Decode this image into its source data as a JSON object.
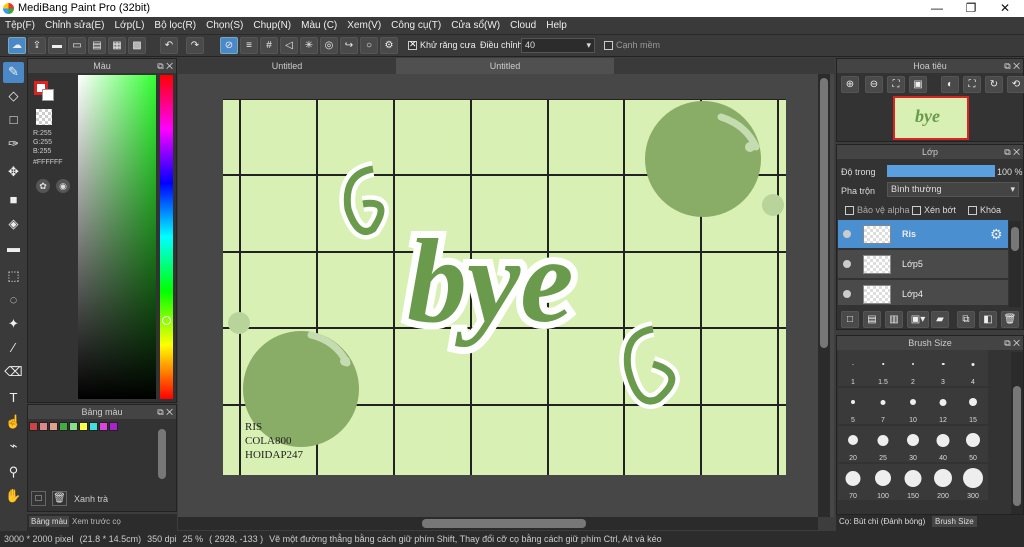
{
  "window": {
    "title": "MediBang Paint Pro (32bit)",
    "min": "—",
    "max": "❐",
    "close": "✕"
  },
  "menu": [
    "Tệp(F)",
    "Chỉnh sửa(E)",
    "Lớp(L)",
    "Bộ lọc(R)",
    "Chọn(S)",
    "Chụp(N)",
    "Màu (C)",
    "Xem(V)",
    "Công cụ(T)",
    "Cửa sổ(W)",
    "Cloud",
    "Help"
  ],
  "toolbar": {
    "antialias_label": "Khử răng cưa",
    "adjust_label": "Điều chỉnh",
    "adjust_value": "40",
    "edge_label": "Cạnh mềm"
  },
  "tabs": [
    "Untitled",
    "Untitled"
  ],
  "color_panel": {
    "title": "Màu",
    "r": "R:255",
    "g": "G:255",
    "b": "B:255",
    "hex": "#FFFFFF"
  },
  "palette_panel": {
    "title": "Bảng màu",
    "swatches": [
      "#cc4444",
      "#dd8888",
      "#e0a090",
      "#44aa44",
      "#88dd88",
      "#ffff44",
      "#44dddd",
      "#dd44dd",
      "#aa22cc"
    ],
    "delete_label": "Xanh trà"
  },
  "bottom_tabs": [
    "Bảng màu",
    "Xem trước cọ"
  ],
  "canvas": {
    "word": "bye",
    "credit": [
      "RIS",
      "COLA800",
      "HOIDAP247"
    ]
  },
  "navigator": {
    "title": "Hoa tiêu",
    "thumb_text": "bye"
  },
  "layer_panel": {
    "title": "Lớp",
    "opacity_label": "Độ trong",
    "opacity_value": "100 %",
    "opacity": 1.0,
    "blend_label": "Pha trộn",
    "blend_value": "Bình thường",
    "protect_alpha": "Bảo vệ alpha",
    "clip": "Xén bớt",
    "lock": "Khóa",
    "layers": [
      {
        "name": "Ris",
        "selected": true
      },
      {
        "name": "Lớp5",
        "selected": false
      },
      {
        "name": "Lớp4",
        "selected": false
      }
    ]
  },
  "brush_panel": {
    "title": "Brush Size",
    "sizes": [
      "1",
      "1.5",
      "2",
      "3",
      "4",
      "5",
      "7",
      "10",
      "12",
      "15",
      "20",
      "25",
      "30",
      "40",
      "50",
      "70",
      "100",
      "150",
      "200",
      "300"
    ]
  },
  "right_bottom_tabs": [
    "Cọ: Bút chì (Đánh bóng)",
    "Brush Size"
  ],
  "status": {
    "size": "3000 * 2000 pixel",
    "cm": "(21.8 * 14.5cm)",
    "dpi": "350 dpi",
    "zoom": "25 %",
    "coord": "( 2928, -133 )",
    "hint": "Vẽ một đường thẳng bằng cách giữ phím Shift, Thay đổi cỡ cọ bằng cách giữ phím Ctrl, Alt và kéo"
  }
}
